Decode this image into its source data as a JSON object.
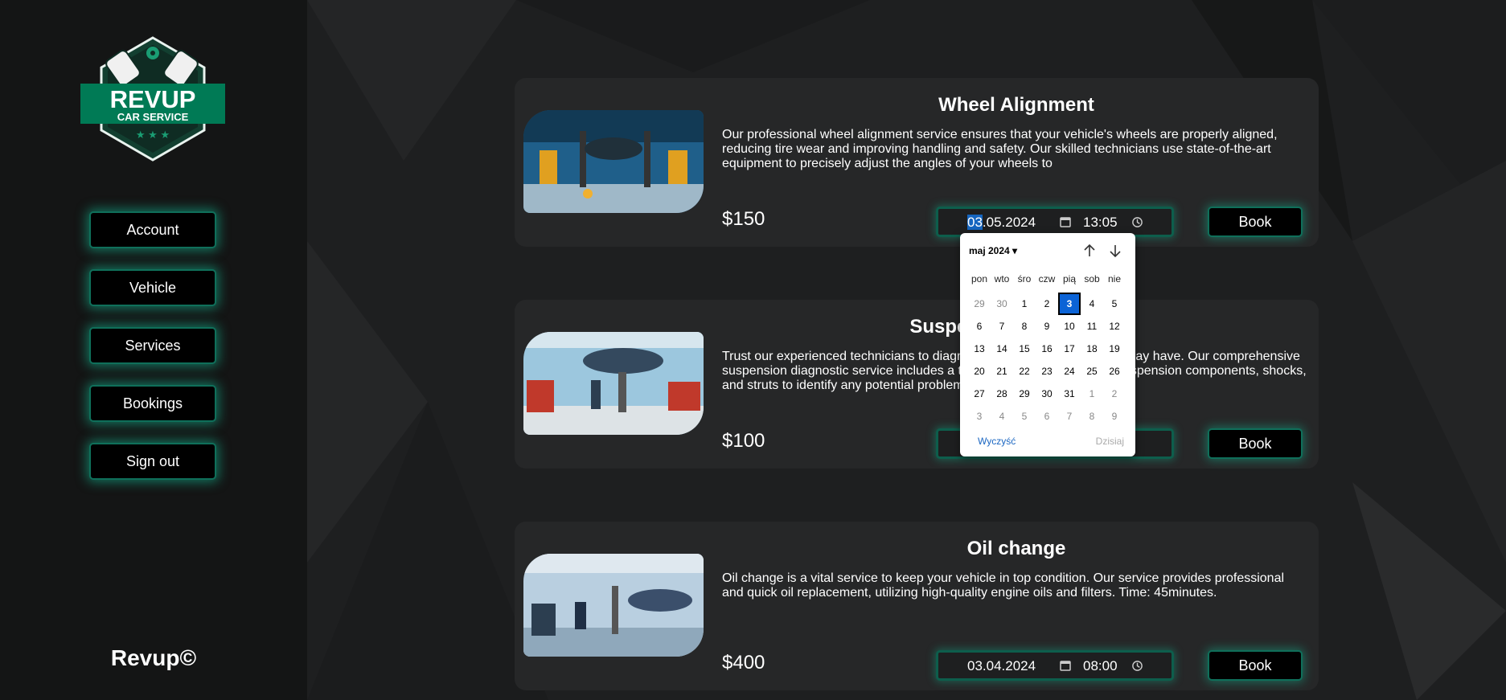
{
  "sidebar": {
    "logo": {
      "title": "REVUP",
      "subtitle": "CAR SERVICE"
    },
    "nav": [
      {
        "label": "Account"
      },
      {
        "label": "Vehicle"
      },
      {
        "label": "Services"
      },
      {
        "label": "Bookings"
      },
      {
        "label": "Sign out"
      }
    ],
    "footer": "Revup©"
  },
  "services": [
    {
      "title": "Wheel Alignment",
      "description": "Our professional wheel alignment service ensures that your vehicle's wheels are properly aligned, reducing tire wear and improving handling and safety. Our skilled technicians use state-of-the-art equipment to precisely adjust the angles of your wheels to",
      "price": "$150",
      "date_selected": "03",
      "date_rest": ".05.2024",
      "time": "13:05",
      "book_label": "Book"
    },
    {
      "title": "Suspension Diagnostic",
      "description": "Trust our experienced technicians to diagnose any issues your vehicle may have. Our comprehensive suspension diagnostic service includes a thorough inspection of your suspension components, shocks, and struts to identify any potential problems.",
      "price": "$100",
      "date_selected": "",
      "date_rest": "",
      "time": "",
      "book_label": "Book"
    },
    {
      "title": "Oil change",
      "description": "Oil change is a vital service to keep your vehicle in top condition. Our service provides professional and quick oil replacement, utilizing high-quality engine oils and filters. Time: 45minutes.",
      "price": "$400",
      "date_selected": "",
      "date_rest": "03.04.2024",
      "time": "08:00",
      "book_label": "Book"
    }
  ],
  "date_picker": {
    "month_label": "maj 2024 ▾",
    "weekdays": [
      "pon",
      "wto",
      "śro",
      "czw",
      "pią",
      "sob",
      "nie"
    ],
    "weeks": [
      [
        "29",
        "30",
        "1",
        "2",
        "3",
        "4",
        "5"
      ],
      [
        "6",
        "7",
        "8",
        "9",
        "10",
        "11",
        "12"
      ],
      [
        "13",
        "14",
        "15",
        "16",
        "17",
        "18",
        "19"
      ],
      [
        "20",
        "21",
        "22",
        "23",
        "24",
        "25",
        "26"
      ],
      [
        "27",
        "28",
        "29",
        "30",
        "31",
        "1",
        "2"
      ],
      [
        "3",
        "4",
        "5",
        "6",
        "7",
        "8",
        "9"
      ]
    ],
    "other_month": [
      [
        0,
        0
      ],
      [
        0,
        1
      ],
      [
        4,
        5
      ],
      [
        4,
        6
      ],
      [
        5,
        0
      ],
      [
        5,
        1
      ],
      [
        5,
        2
      ],
      [
        5,
        3
      ],
      [
        5,
        4
      ],
      [
        5,
        5
      ],
      [
        5,
        6
      ]
    ],
    "selected": [
      0,
      4
    ],
    "clear_label": "Wyczyść",
    "today_label": "Dzisiaj"
  },
  "colors": {
    "accent": "#12be96",
    "sidebar_bg": "#141515",
    "card_bg": "#262728",
    "selected_day": "#0b63d6"
  }
}
